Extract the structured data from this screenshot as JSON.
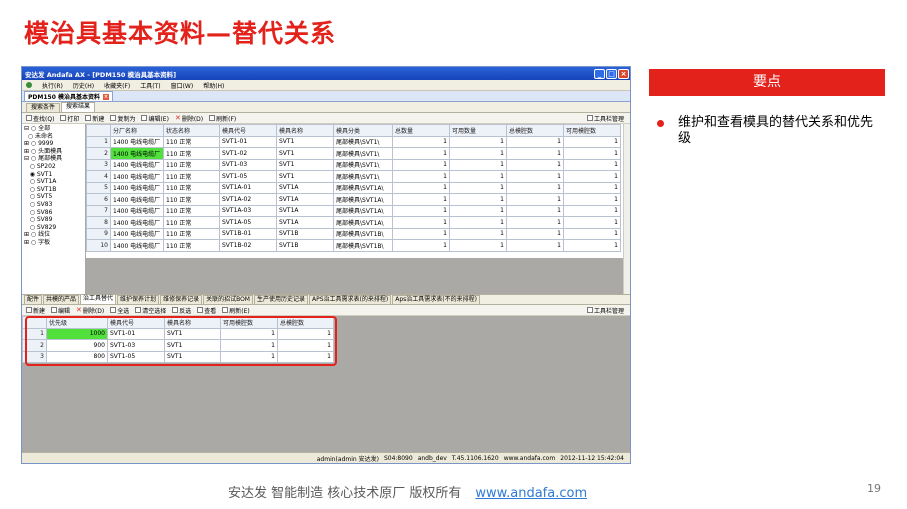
{
  "slide": {
    "title": "模治具基本资料—替代关系",
    "keypoints_header": "要点",
    "bullet": "维护和查看模具的替代关系和优先级",
    "footer_text": "安达发  智能制造 核心技术原厂   版权所有",
    "footer_link": "www.andafa.com",
    "page_number": "19"
  },
  "app": {
    "window_title": "安达发 Andafa AX - [PDM150 模治具基本资料]",
    "menu": [
      "执行(R)",
      "历史(H)",
      "收藏夹(F)",
      "工具(T)",
      "窗口(W)",
      "帮助(H)"
    ],
    "doc_tab": "PDM150 模治具基本资料",
    "sub_tabs": [
      "搜索条件",
      "搜索结果"
    ],
    "toolbar": [
      "查找(Q)",
      "打印",
      "新建",
      "复制为",
      "编辑(E)",
      "删除(D)",
      "刷新(F)"
    ],
    "toolbar_right": "工具栏管理",
    "tree": [
      "全部",
      "未命名",
      "9999",
      "头面模具",
      "尾部模具",
      "SP202",
      "SVT1",
      "SVT1A",
      "SVT1B",
      "SVT5",
      "SV83",
      "SV86",
      "SV89",
      "SV829",
      "线位",
      "字板"
    ],
    "main_grid": {
      "columns": [
        "分厂名称",
        "状态名称",
        "模具代号",
        "模具名称",
        "模具分类",
        "总数量",
        "可用数量",
        "总模腔数",
        "可用模腔数"
      ],
      "rows": [
        {
          "n": "1",
          "factory": "1400 电线电缆厂",
          "status": "110 正常",
          "code": "SVT1-01",
          "name": "SVT1",
          "class": "尾部模具\\SVT1\\",
          "total": "1",
          "avail": "1",
          "cav": "1",
          "avail_cav": "1"
        },
        {
          "n": "2",
          "factory": "1400 电线电缆厂",
          "status": "110 正常",
          "code": "SVT1-02",
          "name": "SVT1",
          "class": "尾部模具\\SVT1\\",
          "total": "1",
          "avail": "1",
          "cav": "1",
          "avail_cav": "1"
        },
        {
          "n": "3",
          "factory": "1400 电线电缆厂",
          "status": "110 正常",
          "code": "SVT1-03",
          "name": "SVT1",
          "class": "尾部模具\\SVT1\\",
          "total": "1",
          "avail": "1",
          "cav": "1",
          "avail_cav": "1"
        },
        {
          "n": "4",
          "factory": "1400 电线电缆厂",
          "status": "110 正常",
          "code": "SVT1-05",
          "name": "SVT1",
          "class": "尾部模具\\SVT1\\",
          "total": "1",
          "avail": "1",
          "cav": "1",
          "avail_cav": "1"
        },
        {
          "n": "5",
          "factory": "1400 电线电缆厂",
          "status": "110 正常",
          "code": "SVT1A-01",
          "name": "SVT1A",
          "class": "尾部模具\\SVT1A\\",
          "total": "1",
          "avail": "1",
          "cav": "1",
          "avail_cav": "1"
        },
        {
          "n": "6",
          "factory": "1400 电线电缆厂",
          "status": "110 正常",
          "code": "SVT1A-02",
          "name": "SVT1A",
          "class": "尾部模具\\SVT1A\\",
          "total": "1",
          "avail": "1",
          "cav": "1",
          "avail_cav": "1"
        },
        {
          "n": "7",
          "factory": "1400 电线电缆厂",
          "status": "110 正常",
          "code": "SVT1A-03",
          "name": "SVT1A",
          "class": "尾部模具\\SVT1A\\",
          "total": "1",
          "avail": "1",
          "cav": "1",
          "avail_cav": "1"
        },
        {
          "n": "8",
          "factory": "1400 电线电缆厂",
          "status": "110 正常",
          "code": "SVT1A-05",
          "name": "SVT1A",
          "class": "尾部模具\\SVT1A\\",
          "total": "1",
          "avail": "1",
          "cav": "1",
          "avail_cav": "1"
        },
        {
          "n": "9",
          "factory": "1400 电线电缆厂",
          "status": "110 正常",
          "code": "SVT1B-01",
          "name": "SVT1B",
          "class": "尾部模具\\SVT1B\\",
          "total": "1",
          "avail": "1",
          "cav": "1",
          "avail_cav": "1"
        },
        {
          "n": "10",
          "factory": "1400 电线电缆厂",
          "status": "110 正常",
          "code": "SVT1B-02",
          "name": "SVT1B",
          "class": "尾部模具\\SVT1B\\",
          "total": "1",
          "avail": "1",
          "cav": "1",
          "avail_cav": "1"
        }
      ]
    },
    "bottom_tabs": [
      "配件",
      "共模的产品",
      "治工具替代",
      "维护保养计划",
      "维修保养记录",
      "关联的招试BOM",
      "生产使用历史记录",
      "APS治工具需求表(的来排程)",
      "Aps治工具需求表(不的来排程)"
    ],
    "bottom_toolbar": [
      "新建",
      "编辑",
      "删除(D)",
      "全选",
      "清空选择",
      "反选",
      "查看",
      "刷新(E)"
    ],
    "sub_grid": {
      "columns": [
        "优先级",
        "模具代号",
        "模具名称",
        "可用模腔数",
        "总模腔数"
      ],
      "rows": [
        {
          "n": "1",
          "priority": "1000",
          "code": "SVT1-01",
          "name": "SVT1",
          "avail_cav": "1",
          "cav": "1"
        },
        {
          "n": "2",
          "priority": "900",
          "code": "SVT1-03",
          "name": "SVT1",
          "avail_cav": "1",
          "cav": "1"
        },
        {
          "n": "3",
          "priority": "800",
          "code": "SVT1-05",
          "name": "SVT1",
          "avail_cav": "1",
          "cav": "1"
        }
      ]
    },
    "status": [
      "admin(admin 安达发)",
      "S04:8090",
      "andb_dev",
      "T.45.1106.1620",
      "www.andafa.com",
      "2012-11-12 15:42:04"
    ]
  }
}
